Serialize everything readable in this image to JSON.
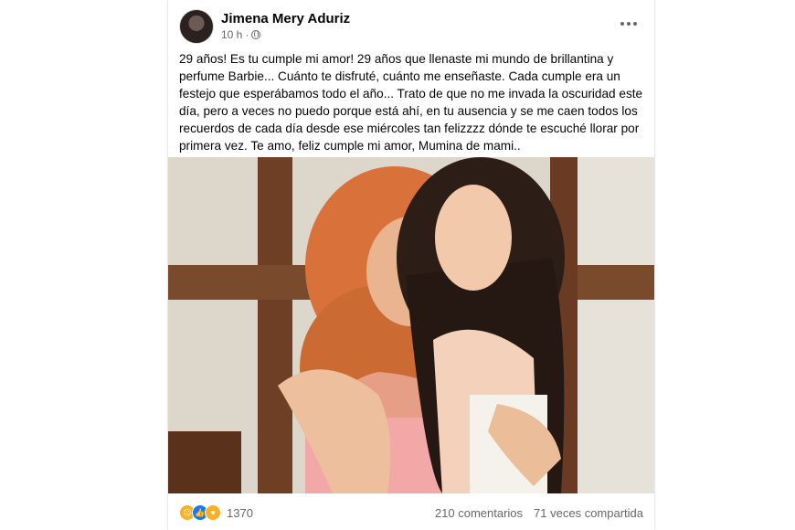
{
  "post": {
    "author": "Jimena Mery Aduriz",
    "time": "10 h",
    "separator": "·",
    "text": "29 años! Es tu cumple mi amor! 29 años que llenaste mi mundo de brillantina y perfume Barbie... Cuánto te disfruté, cuánto me enseñaste. Cada cumple era un festejo que esperábamos todo el año... Trato de que no me invada la oscuridad este día, pero a veces no puedo porque está ahí, en tu ausencia y se me caen todos los recuerdos de cada día desde ese miércoles tan felizzzz dónde te escuché llorar por primera vez. Te amo, feliz cumple mi amor, Mumina de mami..",
    "privacy_icon": "globe-icon"
  },
  "stats": {
    "reaction_icons": [
      "sad-reaction-icon",
      "like-reaction-icon",
      "care-reaction-icon"
    ],
    "reactions": "1370",
    "comments": "210 comentarios",
    "shares": "71 veces compartida"
  },
  "colors": {
    "text": "#050505",
    "secondary": "#65676b",
    "like": "#1877f2",
    "sad": "#f7b125"
  }
}
